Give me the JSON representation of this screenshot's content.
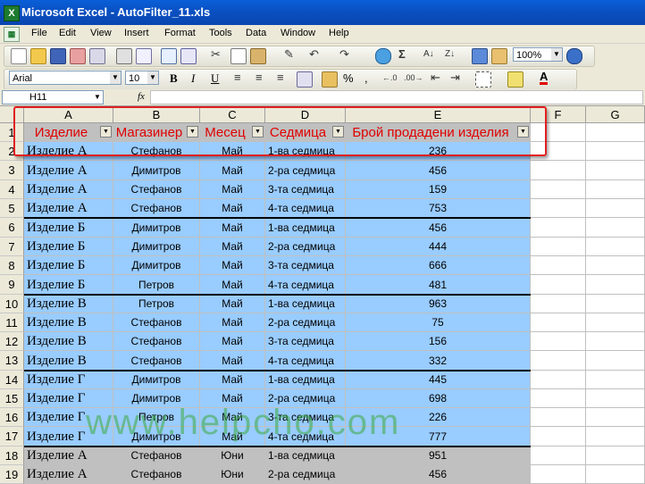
{
  "window": {
    "title": "Microsoft Excel - AutoFilter_11.xls",
    "app_icon": "excel-icon"
  },
  "menu": {
    "items": [
      "File",
      "Edit",
      "View",
      "Insert",
      "Format",
      "Tools",
      "Data",
      "Window",
      "Help"
    ]
  },
  "toolbar": {
    "sigma": "Σ",
    "zoom": "100%",
    "font_name": "Arial",
    "font_size": "10",
    "bold": "B",
    "italic": "I",
    "underline": "U",
    "percent": "%",
    "comma": ",",
    "font_color_label": "A"
  },
  "formula_bar": {
    "name_box": "H11",
    "fx": "fx",
    "content": ""
  },
  "columns": [
    "A",
    "B",
    "C",
    "D",
    "E",
    "F",
    "G"
  ],
  "header_row": {
    "row_number": "1",
    "cells": [
      "Изделие",
      "Магазинер",
      "Месец",
      "Седмица",
      "Брой продадени изделия"
    ]
  },
  "rows": [
    {
      "num": "2",
      "cells": [
        "Изделие А",
        "Стефанов",
        "Май",
        "1-ва седмица",
        "236"
      ],
      "group": "blue"
    },
    {
      "num": "3",
      "cells": [
        "Изделие А",
        "Димитров",
        "Май",
        "2-ра седмица",
        "456"
      ],
      "group": "blue"
    },
    {
      "num": "4",
      "cells": [
        "Изделие А",
        "Стефанов",
        "Май",
        "3-та седмица",
        "159"
      ],
      "group": "blue"
    },
    {
      "num": "5",
      "cells": [
        "Изделие А",
        "Стефанов",
        "Май",
        "4-та седмица",
        "753"
      ],
      "group": "blue"
    },
    {
      "num": "6",
      "cells": [
        "Изделие Б",
        "Димитров",
        "Май",
        "1-ва седмица",
        "456"
      ],
      "group": "blue"
    },
    {
      "num": "7",
      "cells": [
        "Изделие Б",
        "Димитров",
        "Май",
        "2-ра седмица",
        "444"
      ],
      "group": "blue"
    },
    {
      "num": "8",
      "cells": [
        "Изделие Б",
        "Димитров",
        "Май",
        "3-та седмица",
        "666"
      ],
      "group": "blue"
    },
    {
      "num": "9",
      "cells": [
        "Изделие Б",
        "Петров",
        "Май",
        "4-та седмица",
        "481"
      ],
      "group": "blue"
    },
    {
      "num": "10",
      "cells": [
        "Изделие В",
        "Петров",
        "Май",
        "1-ва седмица",
        "963"
      ],
      "group": "blue"
    },
    {
      "num": "11",
      "cells": [
        "Изделие В",
        "Стефанов",
        "Май",
        "2-ра седмица",
        "75"
      ],
      "group": "blue"
    },
    {
      "num": "12",
      "cells": [
        "Изделие В",
        "Стефанов",
        "Май",
        "3-та седмица",
        "156"
      ],
      "group": "blue"
    },
    {
      "num": "13",
      "cells": [
        "Изделие В",
        "Стефанов",
        "Май",
        "4-та седмица",
        "332"
      ],
      "group": "blue"
    },
    {
      "num": "14",
      "cells": [
        "Изделие Г",
        "Димитров",
        "Май",
        "1-ва седмица",
        "445"
      ],
      "group": "blue"
    },
    {
      "num": "15",
      "cells": [
        "Изделие Г",
        "Димитров",
        "Май",
        "2-ра седмица",
        "698"
      ],
      "group": "blue"
    },
    {
      "num": "16",
      "cells": [
        "Изделие Г",
        "Петров",
        "Май",
        "3-та седмица",
        "226"
      ],
      "group": "blue"
    },
    {
      "num": "17",
      "cells": [
        "Изделие Г",
        "Димитров",
        "Май",
        "4-та седмица",
        "777"
      ],
      "group": "blue"
    },
    {
      "num": "18",
      "cells": [
        "Изделие А",
        "Стефанов",
        "Юни",
        "1-ва седмица",
        "951"
      ],
      "group": "gray"
    },
    {
      "num": "19",
      "cells": [
        "Изделие А",
        "Стефанов",
        "Юни",
        "2-ра седмица",
        "456"
      ],
      "group": "gray"
    }
  ],
  "watermark": "www.helpcho.com",
  "colors": {
    "title_bar": "#0a5fd8",
    "header_fill": "#c0c0c0",
    "header_text": "#e00000",
    "blue_fill": "#99ccff",
    "gray_fill": "#c0c0c0",
    "highlight": "#e02020"
  }
}
